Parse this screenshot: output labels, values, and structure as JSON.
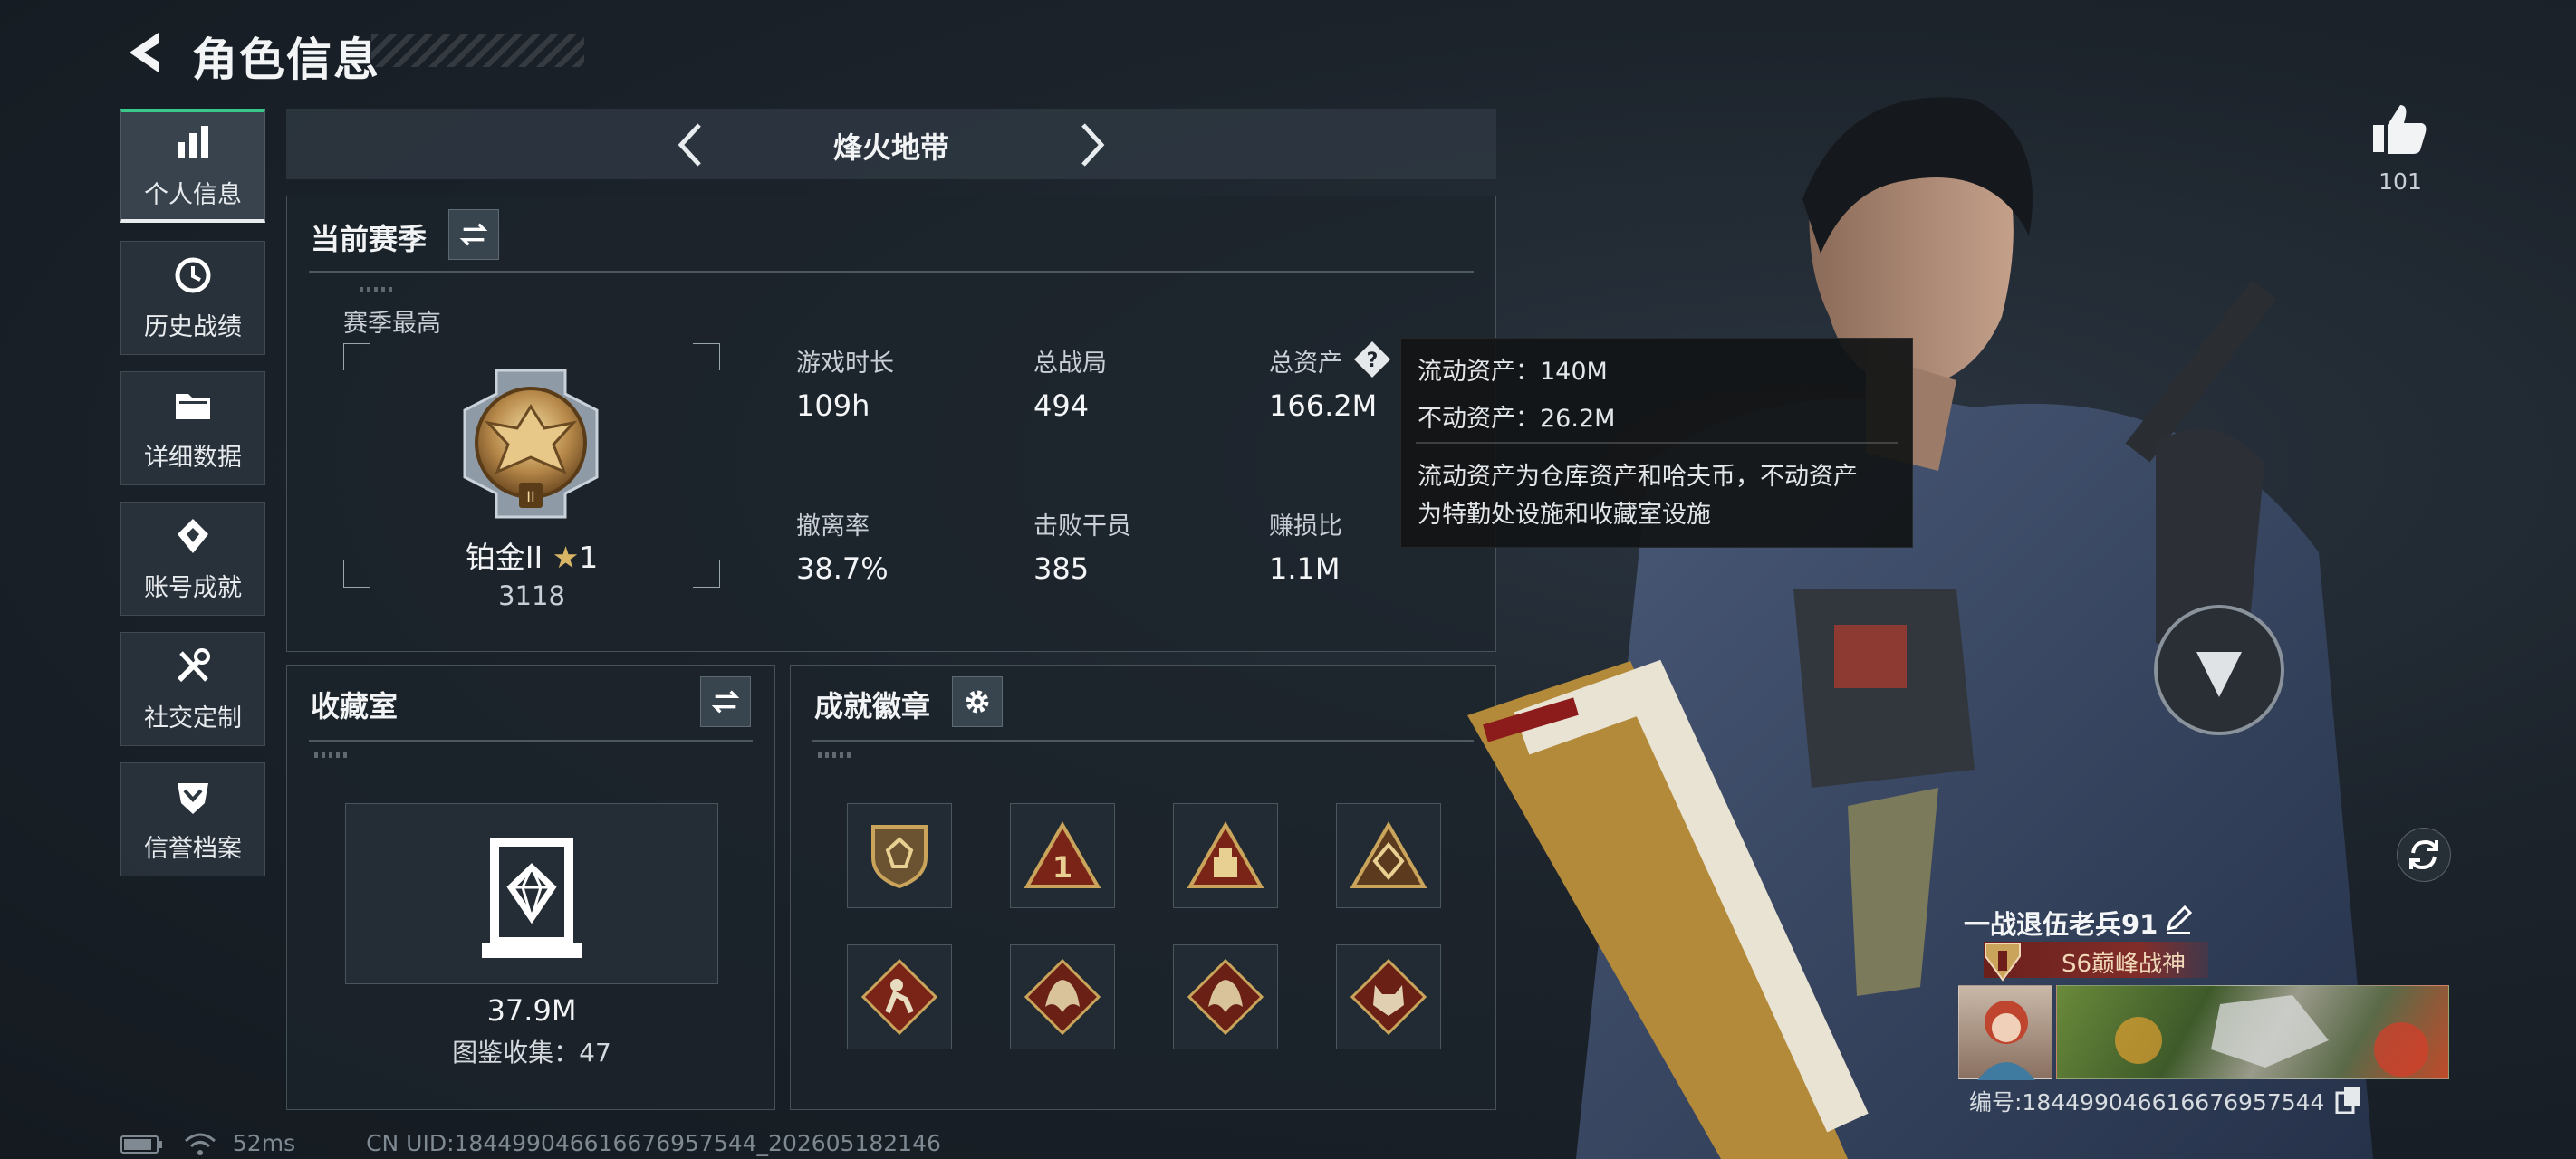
{
  "header": {
    "title": "角色信息"
  },
  "sidebar": {
    "items": [
      {
        "label": "个人信息",
        "icon": "bar-chart-icon",
        "active": true
      },
      {
        "label": "历史战绩",
        "icon": "clock-history-icon"
      },
      {
        "label": "详细数据",
        "icon": "folder-icon"
      },
      {
        "label": "账号成就",
        "icon": "achievement-diamond-icon"
      },
      {
        "label": "社交定制",
        "icon": "tools-icon"
      },
      {
        "label": "信誉档案",
        "icon": "shield-chevron-icon"
      }
    ]
  },
  "mode": {
    "title": "烽火地带"
  },
  "season": {
    "title": "当前赛季",
    "best_label": "赛季最高",
    "rank_name": "铂金II",
    "rank_stars": "1",
    "rank_points": "3118",
    "stats": [
      {
        "label": "游戏时长",
        "value": "109h"
      },
      {
        "label": "总战局",
        "value": "494"
      },
      {
        "label": "总资产",
        "value": "166.2M"
      },
      {
        "label": "撤离率",
        "value": "38.7%"
      },
      {
        "label": "击败干员",
        "value": "385"
      },
      {
        "label": "赚损比",
        "value": "1.1M"
      }
    ]
  },
  "tooltip": {
    "line1": "流动资产：140M",
    "line2": "不动资产：26.2M",
    "desc1": "流动资产为仓库资产和哈夫币，不动资产",
    "desc2": "为特勤处设施和收藏室设施"
  },
  "collection": {
    "title": "收藏室",
    "value": "37.9M",
    "catalog": "图鉴收集：47"
  },
  "badges": {
    "title": "成就徽章",
    "items": [
      "shield-badge-icon",
      "triangle-one-badge-icon",
      "triangle-crate-badge-icon",
      "triangle-gem-badge-icon",
      "diamond-soldier-badge-icon",
      "diamond-dragon-badge-icon",
      "diamond-dragon-badge-icon",
      "diamond-wolf-badge-icon"
    ]
  },
  "likes": {
    "count": "101"
  },
  "profile": {
    "name": "一战退伍老兵91",
    "title": "S6巅峰战神",
    "id_text": "编号:1844990466166769575​44"
  },
  "status": {
    "ping": "52ms",
    "uid": "CN UID:1844990466166769575​44_202605182146"
  },
  "colors": {
    "accent_green": "#38c98a",
    "title_red": "#8f2a22",
    "gold": "#c9a45a"
  }
}
